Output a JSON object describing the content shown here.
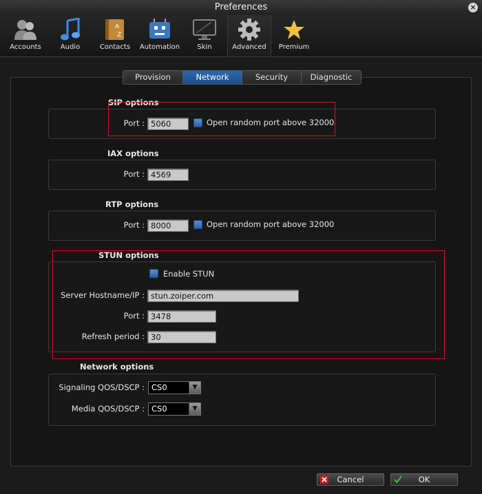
{
  "window": {
    "title": "Preferences"
  },
  "toolbar": {
    "items": [
      {
        "label": "Accounts",
        "icon": "accounts-icon"
      },
      {
        "label": "Audio",
        "icon": "audio-icon"
      },
      {
        "label": "Contacts",
        "icon": "contacts-icon"
      },
      {
        "label": "Automation",
        "icon": "automation-icon"
      },
      {
        "label": "Skin",
        "icon": "skin-icon"
      },
      {
        "label": "Advanced",
        "icon": "advanced-icon",
        "active": true
      },
      {
        "label": "Premium",
        "icon": "premium-icon"
      }
    ]
  },
  "tabs": [
    {
      "label": "Provision"
    },
    {
      "label": "Network",
      "active": true
    },
    {
      "label": "Security"
    },
    {
      "label": "Diagnostic"
    }
  ],
  "sip": {
    "title": "SIP options",
    "port_label": "Port :",
    "port_value": "5060",
    "random_label": "Open random port above 32000"
  },
  "iax": {
    "title": "IAX options",
    "port_label": "Port :",
    "port_value": "4569"
  },
  "rtp": {
    "title": "RTP options",
    "port_label": "Port :",
    "port_value": "8000",
    "random_label": "Open random port above 32000"
  },
  "stun": {
    "title": "STUN options",
    "enable_label": "Enable STUN",
    "host_label": "Server Hostname/IP :",
    "host_value": "stun.zoiper.com",
    "port_label": "Port :",
    "port_value": "3478",
    "refresh_label": "Refresh period :",
    "refresh_value": "30"
  },
  "network": {
    "title": "Network options",
    "signaling_label": "Signaling QOS/DSCP :",
    "signaling_value": "CS0",
    "media_label": "Media QOS/DSCP :",
    "media_value": "CS0"
  },
  "buttons": {
    "cancel": "Cancel",
    "ok": "OK"
  },
  "colors": {
    "accent": "#2b6ab0",
    "highlight": "#e01010"
  }
}
